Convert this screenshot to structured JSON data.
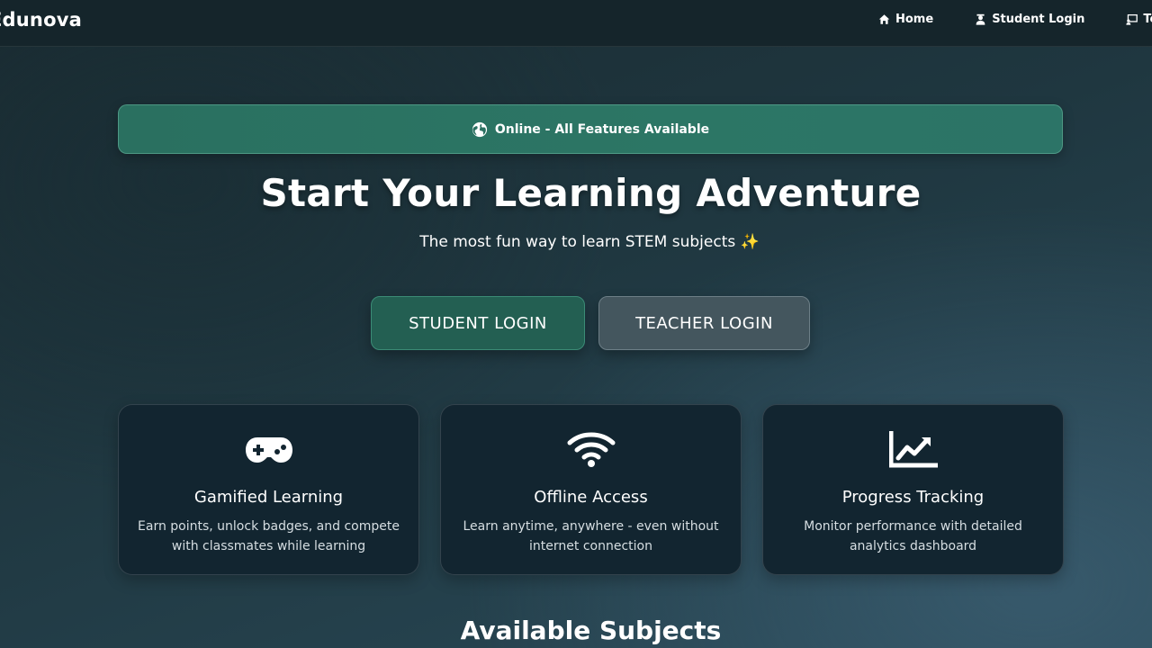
{
  "navbar": {
    "brand": "Edunova",
    "links": [
      {
        "label": "Home",
        "icon": "home-icon"
      },
      {
        "label": "Student Login",
        "icon": "user-graduate-icon"
      },
      {
        "label": "Teach",
        "icon": "chalkboard-teacher-icon"
      }
    ]
  },
  "status": {
    "icon": "globe-icon",
    "text": "Online - All Features Available",
    "color": "#2a7060"
  },
  "hero": {
    "title": "Start Your Learning Adventure",
    "subtitle": "The most fun way to learn STEM subjects ✨"
  },
  "actions": {
    "student_label": "STUDENT LOGIN",
    "teacher_label": "TEACHER LOGIN",
    "student_color": "#235f52",
    "teacher_color": "#44565e"
  },
  "features": [
    {
      "icon": "gamepad-icon",
      "title": "Gamified Learning",
      "description": "Earn points, unlock badges, and compete with classmates while learning"
    },
    {
      "icon": "wifi-icon",
      "title": "Offline Access",
      "description": "Learn anytime, anywhere - even without internet connection"
    },
    {
      "icon": "chart-line-icon",
      "title": "Progress Tracking",
      "description": "Monitor performance with detailed analytics dashboard"
    }
  ],
  "subjects_section": {
    "title": "Available Subjects"
  }
}
